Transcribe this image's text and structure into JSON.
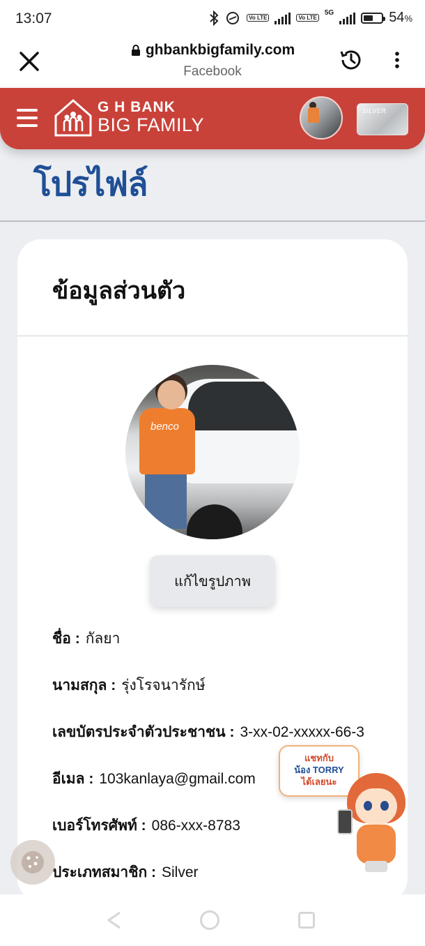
{
  "status_bar": {
    "time": "13:07",
    "signal_tag": "Vo LTE",
    "network": "5G",
    "battery_percent": "54",
    "battery_suffix": "%",
    "battery_level": 0.54
  },
  "browser": {
    "url": "ghbankbigfamily.com",
    "source": "Facebook"
  },
  "header": {
    "logo_line1": "G H BANK",
    "logo_line2": "BIG FAMILY",
    "tier_card_label": "SILVER"
  },
  "page": {
    "title": "โปรไฟล์"
  },
  "profile_card": {
    "title": "ข้อมูลส่วนตัว",
    "photo_shirt_text": "benco",
    "edit_photo_button": "แก้ไขรูปภาพ",
    "fields": [
      {
        "label": "ชื่อ :",
        "value": "กัลยา"
      },
      {
        "label": "นามสกุล :",
        "value": "รุ่งโรจนารักษ์"
      },
      {
        "label": "เลขบัตรประจำตัวประชาชน :",
        "value": "3-xx-02-xxxxx-66-3"
      },
      {
        "label": "อีเมล :",
        "value": "103kanlaya@gmail.com"
      },
      {
        "label": "เบอร์โทรศัพท์ :",
        "value": "086-xxx-8783"
      },
      {
        "label": "ประเภทสมาชิก :",
        "value": "Silver"
      }
    ]
  },
  "chat_widget": {
    "line1": "แชทกับ",
    "line2": "น้อง TORRY",
    "line3": "ได้เลยนะ"
  },
  "colors": {
    "brand_red": "#c9423a",
    "title_blue": "#1f4f96",
    "page_bg": "#eceef1"
  }
}
